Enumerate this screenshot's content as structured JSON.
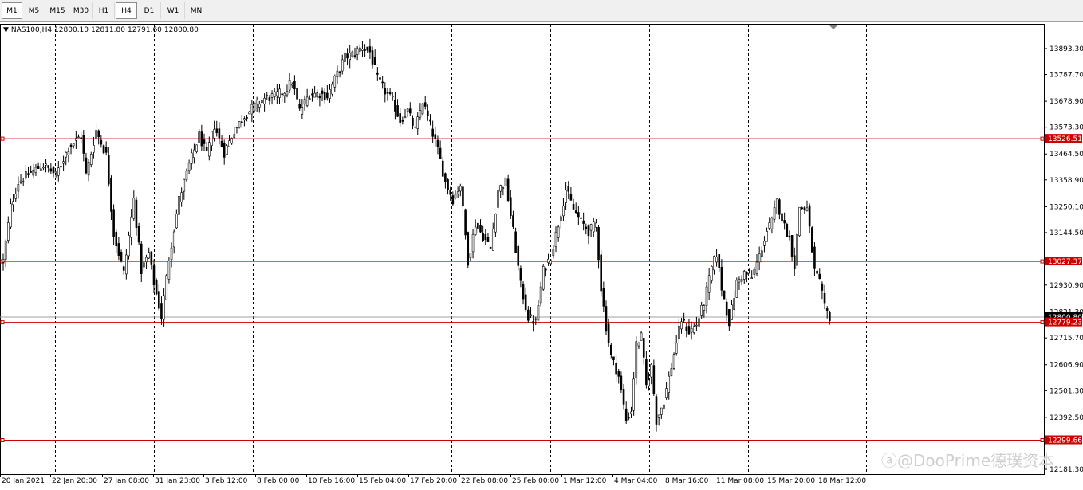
{
  "toolbar": {
    "timeframes": [
      {
        "label": "M1",
        "active": false,
        "selected_left": true
      },
      {
        "label": "M5"
      },
      {
        "label": "M15"
      },
      {
        "label": "M30"
      },
      {
        "label": "H1"
      },
      {
        "label": "H4",
        "active": true
      },
      {
        "label": "D1"
      },
      {
        "label": "W1"
      },
      {
        "label": "MN"
      }
    ]
  },
  "symbol_info": {
    "dropdown_icon": "triangle-down-icon",
    "symbol": "NAS100,H4",
    "open": "12800.10",
    "high": "12811.80",
    "low": "12791.60",
    "close": "12800.80"
  },
  "price_axis": {
    "labels": [
      "13893.30",
      "13787.70",
      "13678.90",
      "13573.30",
      "13464.50",
      "13358.90",
      "13250.10",
      "13144.50",
      "12930.90",
      "12821.30",
      "12715.70",
      "12606.90",
      "12501.30",
      "12392.50",
      "12181.30"
    ]
  },
  "horizontal_lines": [
    {
      "value": 13526.51,
      "label": "13526.51",
      "color": "#cc0000"
    },
    {
      "value": 13027.37,
      "label": "13027.37",
      "color": "#cc0000"
    },
    {
      "value": 12779.23,
      "label": "12779.23",
      "color": "#cc0000"
    },
    {
      "value": 12299.66,
      "label": "12299.66",
      "color": "#cc0000"
    }
  ],
  "bid_line": {
    "value": 12800.8,
    "color": "#a0a0a0"
  },
  "time_axis": {
    "labels": [
      "20 Jan 2021",
      "22 Jan 20:00",
      "27 Jan 08:00",
      "31 Jan 23:00",
      "3 Feb 12:00",
      "8 Feb 00:00",
      "10 Feb 16:00",
      "15 Feb 04:00",
      "17 Feb 20:00",
      "22 Feb 08:00",
      "25 Feb 00:00",
      "1 Mar 12:00",
      "4 Mar 04:00",
      "8 Mar 16:00",
      "11 Mar 08:00",
      "15 Mar 20:00",
      "18 Mar 12:00"
    ]
  },
  "chart_data": {
    "type": "candlestick",
    "symbol": "NAS100",
    "timeframe": "H4",
    "ylim": [
      12150,
      13960
    ],
    "grid": "vertical-dashed",
    "anchors": [
      {
        "bar": 0,
        "price": 13030
      },
      {
        "bar": 3,
        "price": 13250
      },
      {
        "bar": 6,
        "price": 13350
      },
      {
        "bar": 11,
        "price": 13390
      },
      {
        "bar": 16,
        "price": 13420
      },
      {
        "bar": 21,
        "price": 13380
      },
      {
        "bar": 26,
        "price": 13490
      },
      {
        "bar": 31,
        "price": 13540
      },
      {
        "bar": 33,
        "price": 13380
      },
      {
        "bar": 37,
        "price": 13560
      },
      {
        "bar": 41,
        "price": 13460
      },
      {
        "bar": 44,
        "price": 13140
      },
      {
        "bar": 48,
        "price": 12980
      },
      {
        "bar": 52,
        "price": 13280
      },
      {
        "bar": 55,
        "price": 12990
      },
      {
        "bar": 58,
        "price": 13060
      },
      {
        "bar": 60,
        "price": 12940
      },
      {
        "bar": 63,
        "price": 12800
      },
      {
        "bar": 66,
        "price": 13040
      },
      {
        "bar": 70,
        "price": 13280
      },
      {
        "bar": 74,
        "price": 13420
      },
      {
        "bar": 78,
        "price": 13540
      },
      {
        "bar": 81,
        "price": 13460
      },
      {
        "bar": 84,
        "price": 13580
      },
      {
        "bar": 88,
        "price": 13470
      },
      {
        "bar": 92,
        "price": 13560
      },
      {
        "bar": 96,
        "price": 13620
      },
      {
        "bar": 100,
        "price": 13660
      },
      {
        "bar": 104,
        "price": 13690
      },
      {
        "bar": 108,
        "price": 13700
      },
      {
        "bar": 112,
        "price": 13720
      },
      {
        "bar": 115,
        "price": 13760
      },
      {
        "bar": 118,
        "price": 13640
      },
      {
        "bar": 122,
        "price": 13710
      },
      {
        "bar": 126,
        "price": 13710
      },
      {
        "bar": 129,
        "price": 13700
      },
      {
        "bar": 133,
        "price": 13790
      },
      {
        "bar": 136,
        "price": 13860
      },
      {
        "bar": 139,
        "price": 13870
      },
      {
        "bar": 143,
        "price": 13900
      },
      {
        "bar": 146,
        "price": 13880
      },
      {
        "bar": 149,
        "price": 13770
      },
      {
        "bar": 152,
        "price": 13720
      },
      {
        "bar": 155,
        "price": 13680
      },
      {
        "bar": 158,
        "price": 13600
      },
      {
        "bar": 161,
        "price": 13640
      },
      {
        "bar": 164,
        "price": 13560
      },
      {
        "bar": 167,
        "price": 13680
      },
      {
        "bar": 170,
        "price": 13580
      },
      {
        "bar": 173,
        "price": 13480
      },
      {
        "bar": 176,
        "price": 13350
      },
      {
        "bar": 179,
        "price": 13280
      },
      {
        "bar": 182,
        "price": 13340
      },
      {
        "bar": 185,
        "price": 13030
      },
      {
        "bar": 188,
        "price": 13180
      },
      {
        "bar": 191,
        "price": 13130
      },
      {
        "bar": 194,
        "price": 13080
      },
      {
        "bar": 197,
        "price": 13320
      },
      {
        "bar": 200,
        "price": 13350
      },
      {
        "bar": 203,
        "price": 13150
      },
      {
        "bar": 206,
        "price": 12930
      },
      {
        "bar": 209,
        "price": 12800
      },
      {
        "bar": 212,
        "price": 12780
      },
      {
        "bar": 215,
        "price": 12990
      },
      {
        "bar": 218,
        "price": 13050
      },
      {
        "bar": 221,
        "price": 13180
      },
      {
        "bar": 224,
        "price": 13320
      },
      {
        "bar": 227,
        "price": 13240
      },
      {
        "bar": 230,
        "price": 13190
      },
      {
        "bar": 233,
        "price": 13150
      },
      {
        "bar": 236,
        "price": 13180
      },
      {
        "bar": 238,
        "price": 12920
      },
      {
        "bar": 240,
        "price": 12760
      },
      {
        "bar": 242,
        "price": 12640
      },
      {
        "bar": 245,
        "price": 12560
      },
      {
        "bar": 248,
        "price": 12380
      },
      {
        "bar": 250,
        "price": 12420
      },
      {
        "bar": 252,
        "price": 12690
      },
      {
        "bar": 254,
        "price": 12720
      },
      {
        "bar": 256,
        "price": 12520
      },
      {
        "bar": 258,
        "price": 12600
      },
      {
        "bar": 260,
        "price": 12380
      },
      {
        "bar": 263,
        "price": 12460
      },
      {
        "bar": 266,
        "price": 12600
      },
      {
        "bar": 268,
        "price": 12700
      },
      {
        "bar": 270,
        "price": 12790
      },
      {
        "bar": 273,
        "price": 12740
      },
      {
        "bar": 276,
        "price": 12770
      },
      {
        "bar": 279,
        "price": 12860
      },
      {
        "bar": 282,
        "price": 13000
      },
      {
        "bar": 284,
        "price": 13060
      },
      {
        "bar": 286,
        "price": 12920
      },
      {
        "bar": 289,
        "price": 12780
      },
      {
        "bar": 292,
        "price": 12940
      },
      {
        "bar": 295,
        "price": 12980
      },
      {
        "bar": 298,
        "price": 12960
      },
      {
        "bar": 301,
        "price": 13050
      },
      {
        "bar": 304,
        "price": 13150
      },
      {
        "bar": 306,
        "price": 13190
      },
      {
        "bar": 308,
        "price": 13270
      },
      {
        "bar": 311,
        "price": 13170
      },
      {
        "bar": 313,
        "price": 13120
      },
      {
        "bar": 315,
        "price": 13010
      },
      {
        "bar": 317,
        "price": 13250
      },
      {
        "bar": 320,
        "price": 13240
      },
      {
        "bar": 323,
        "price": 12990
      },
      {
        "bar": 325,
        "price": 12940
      },
      {
        "bar": 327,
        "price": 12840
      },
      {
        "bar": 329,
        "price": 12800
      }
    ],
    "last_close": 12800.8
  }
}
